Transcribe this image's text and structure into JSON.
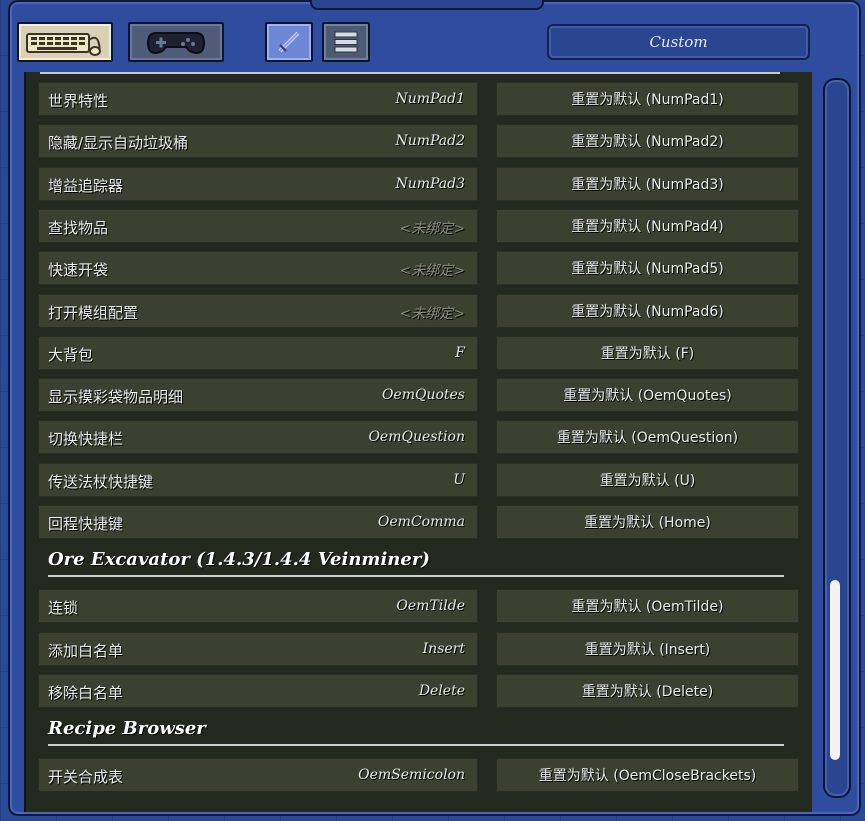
{
  "toolbar": {
    "keyboard_icon": "keyboard-icon",
    "gamepad_icon": "gamepad-icon",
    "sword_icon": "sword-icon",
    "menu_icon": "menu-lines-icon",
    "profile_label": "Custom"
  },
  "rows_group1": [
    {
      "name": "世界特性",
      "bind": "NumPad1",
      "reset": "重置为默认 (NumPad1)",
      "unbound": false
    },
    {
      "name": "隐藏/显示自动垃圾桶",
      "bind": "NumPad2",
      "reset": "重置为默认 (NumPad2)",
      "unbound": false
    },
    {
      "name": "增益追踪器",
      "bind": "NumPad3",
      "reset": "重置为默认 (NumPad3)",
      "unbound": false
    },
    {
      "name": "查找物品",
      "bind": "<未绑定>",
      "reset": "重置为默认 (NumPad4)",
      "unbound": true
    },
    {
      "name": "快速开袋",
      "bind": "<未绑定>",
      "reset": "重置为默认 (NumPad5)",
      "unbound": true
    },
    {
      "name": "打开模组配置",
      "bind": "<未绑定>",
      "reset": "重置为默认 (NumPad6)",
      "unbound": true
    },
    {
      "name": "大背包",
      "bind": "F",
      "reset": "重置为默认 (F)",
      "unbound": false
    },
    {
      "name": "显示摸彩袋物品明细",
      "bind": "OemQuotes",
      "reset": "重置为默认 (OemQuotes)",
      "unbound": false
    },
    {
      "name": "切换快捷栏",
      "bind": "OemQuestion",
      "reset": "重置为默认 (OemQuestion)",
      "unbound": false
    },
    {
      "name": "传送法杖快捷键",
      "bind": "U",
      "reset": "重置为默认 (U)",
      "unbound": false
    },
    {
      "name": "回程快捷键",
      "bind": "OemComma",
      "reset": "重置为默认 (Home)",
      "unbound": false
    }
  ],
  "section_ore": "Ore Excavator (1.4.3/1.4.4 Veinminer)",
  "rows_group2": [
    {
      "name": "连锁",
      "bind": "OemTilde",
      "reset": "重置为默认 (OemTilde)",
      "unbound": false
    },
    {
      "name": "添加白名单",
      "bind": "Insert",
      "reset": "重置为默认 (Insert)",
      "unbound": false
    },
    {
      "name": "移除白名单",
      "bind": "Delete",
      "reset": "重置为默认 (Delete)",
      "unbound": false
    }
  ],
  "section_recipe": "Recipe Browser",
  "rows_group3": [
    {
      "name": "开关合成表",
      "bind": "OemSemicolon",
      "reset": "重置为默认 (OemCloseBrackets)",
      "unbound": false
    }
  ],
  "colors": {
    "panel": "#2f4c9e",
    "row_bg": "#3b4031",
    "list_bg": "#24291f"
  }
}
